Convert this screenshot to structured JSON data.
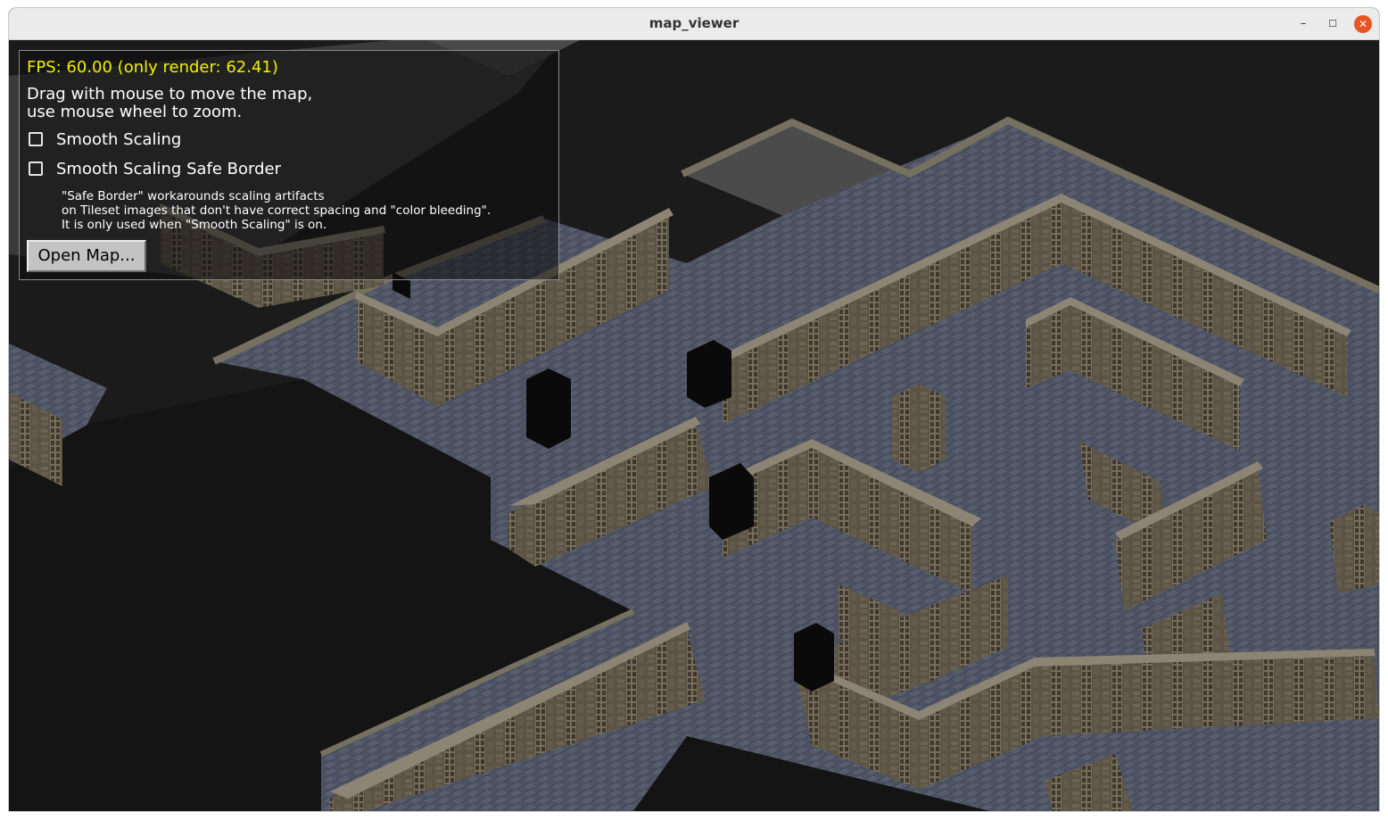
{
  "window": {
    "title": "map_viewer",
    "minimize_glyph": "–",
    "maximize_glyph": "☐",
    "close_glyph": "✕",
    "accent_close": "#e95420"
  },
  "overlay": {
    "fps_text": "FPS: 60.00 (only render: 62.41)",
    "help_line_1": "Drag with mouse to move the map,",
    "help_line_2": "use mouse wheel to zoom.",
    "smooth_scaling": {
      "label": "Smooth Scaling",
      "checked": false
    },
    "smooth_scaling_safe_border": {
      "label": "Smooth Scaling Safe Border",
      "checked": false
    },
    "note_line_1": "\"Safe Border\" workarounds scaling artifacts",
    "note_line_2": "on Tileset images that don't have correct spacing and \"color bleeding\".",
    "note_line_3": "It is only used when \"Smooth Scaling\" is on.",
    "open_map_button": "Open Map..."
  },
  "colors": {
    "fps_text": "#f0f000",
    "background": "#1b1b1b",
    "floor": "#4e5464",
    "wall_face": "#5e5546",
    "wall_top": "#8c8574"
  },
  "map": {
    "icon": "isometric-dungeon-map"
  }
}
